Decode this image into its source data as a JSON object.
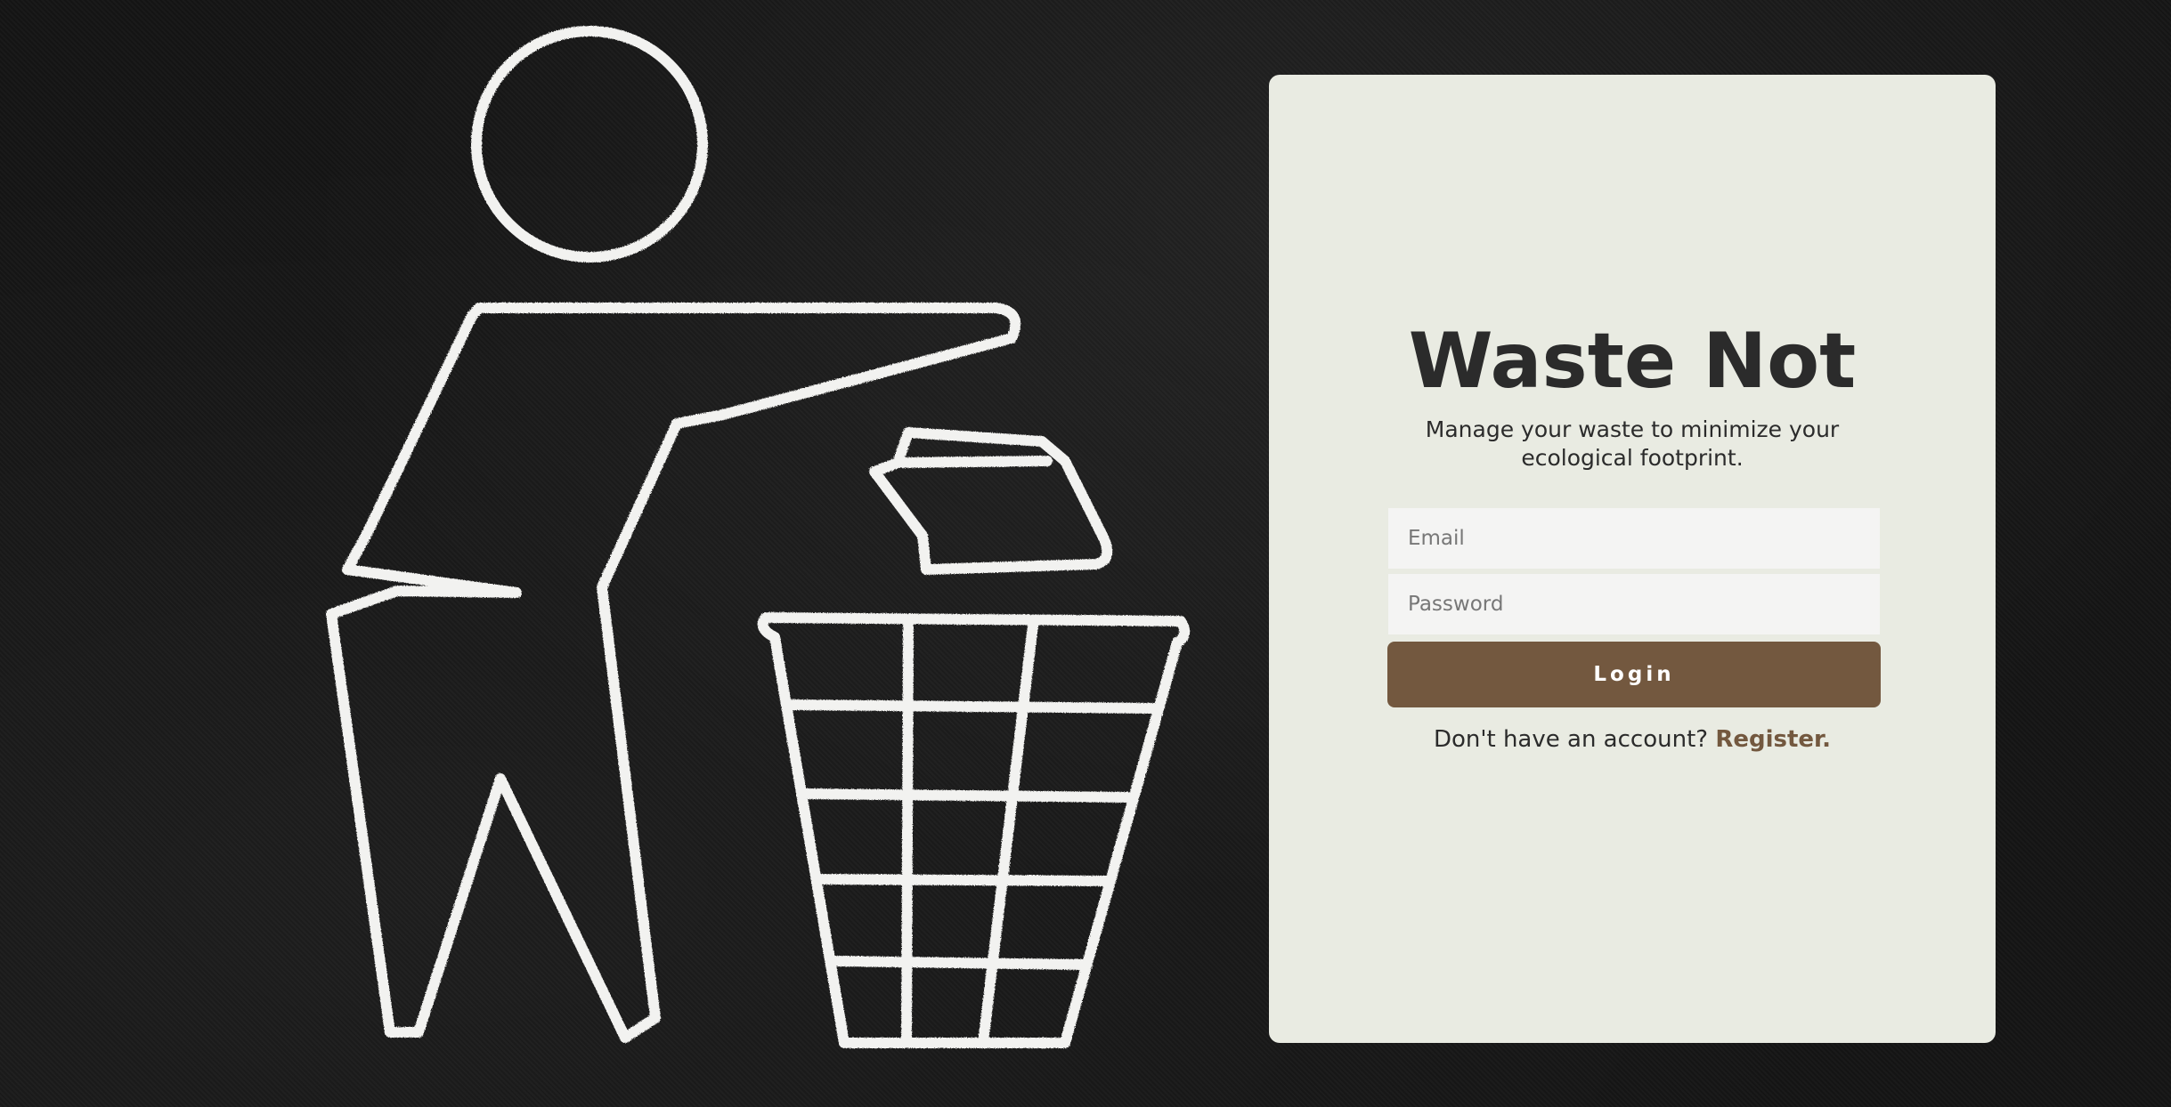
{
  "app": {
    "title": "Waste Not",
    "subtitle": "Manage your waste to minimize your ecological footprint."
  },
  "login_form": {
    "email_placeholder": "Email",
    "password_placeholder": "Password",
    "login_label": "Login",
    "register_prompt": "Don't have an account?",
    "register_link_label": "Register."
  },
  "colors": {
    "background": "#151515",
    "card_background": "#e9ebe2",
    "accent": "#73583f",
    "text": "#2b2b2b",
    "input_background": "#f4f4f3"
  },
  "background_image": {
    "icon": "person-disposing-trash-in-bin-icon"
  }
}
